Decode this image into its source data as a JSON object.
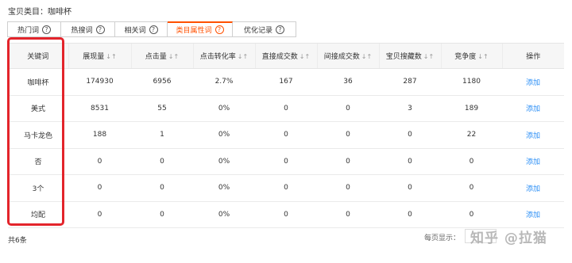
{
  "header": {
    "category": "宝贝类目：咖啡杯"
  },
  "tabs": [
    {
      "label": "热门词",
      "active": false
    },
    {
      "label": "热搜词",
      "active": false
    },
    {
      "label": "相关词",
      "active": false
    },
    {
      "label": "类目属性词",
      "active": true
    },
    {
      "label": "优化记录",
      "active": false
    }
  ],
  "table": {
    "headers": [
      "关键词",
      "展现量",
      "点击量",
      "点击转化率",
      "直接成交数",
      "间接成交数",
      "宝贝搜藏数",
      "竞争度",
      "操作"
    ],
    "sortable": [
      false,
      true,
      true,
      true,
      true,
      true,
      true,
      true,
      false
    ],
    "rows": [
      [
        "咖啡杯",
        "174930",
        "6956",
        "2.7%",
        "167",
        "36",
        "287",
        "1180",
        "添加"
      ],
      [
        "美式",
        "8531",
        "55",
        "0%",
        "0",
        "0",
        "3",
        "189",
        "添加"
      ],
      [
        "马卡龙色",
        "188",
        "1",
        "0%",
        "0",
        "0",
        "0",
        "22",
        "添加"
      ],
      [
        "否",
        "0",
        "0",
        "0%",
        "0",
        "0",
        "0",
        "0",
        "添加"
      ],
      [
        "3个",
        "0",
        "0",
        "0%",
        "0",
        "0",
        "0",
        "0",
        "添加"
      ],
      [
        "均配",
        "0",
        "0",
        "0%",
        "0",
        "0",
        "0",
        "0",
        "添加"
      ]
    ]
  },
  "footer": {
    "count": "共6条",
    "per_page_label": "每页显示："
  },
  "watermark": "知乎 @拉猫",
  "colors": {
    "accent": "#ff5000",
    "link": "#2a8ef6",
    "highlight": "#e3242b"
  },
  "icons": {
    "help": "question-circle-icon",
    "sort": "sort-arrows-icon"
  }
}
